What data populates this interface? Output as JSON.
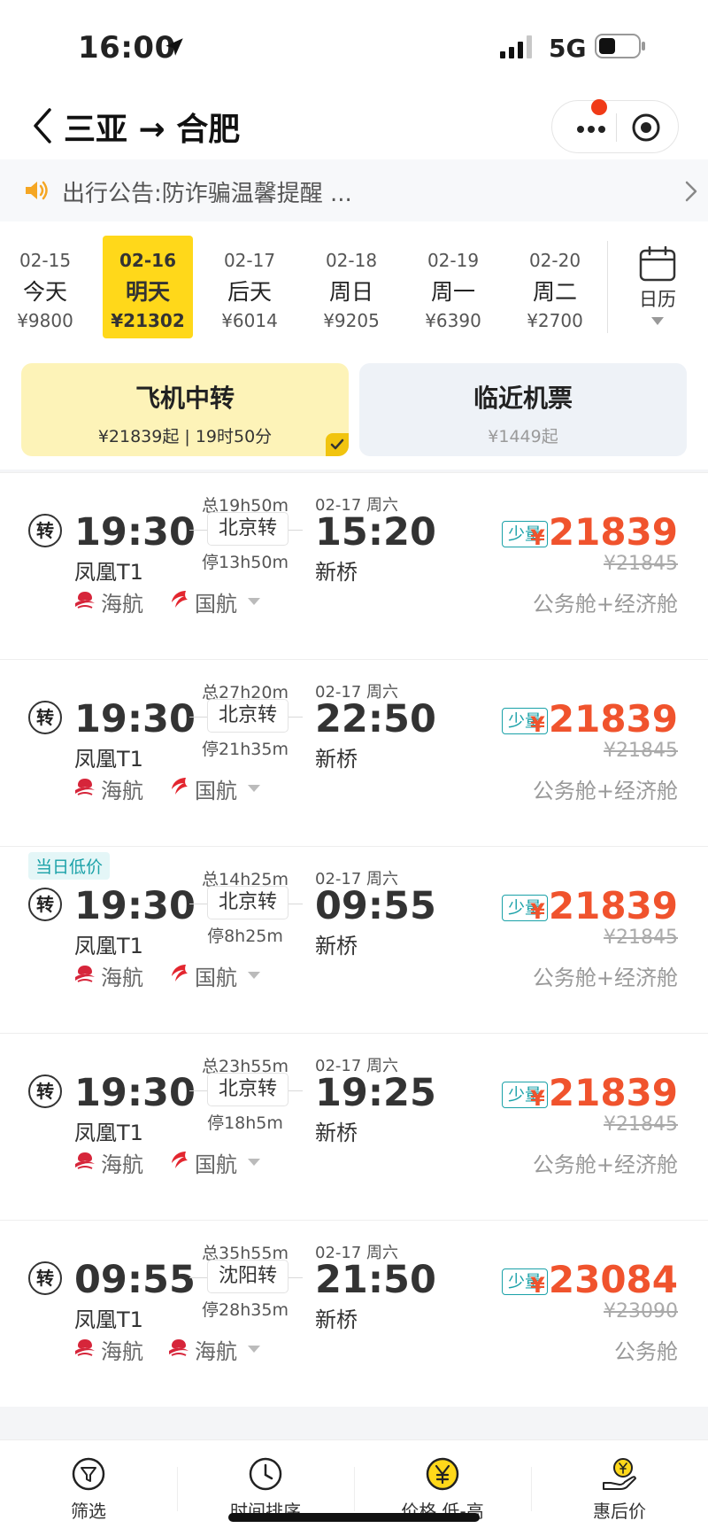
{
  "status_bar": {
    "time": "16:00",
    "network": "5G"
  },
  "header": {
    "title": "三亚 → 合肥"
  },
  "notice": {
    "text": "出行公告:防诈骗温馨提醒 ..."
  },
  "dates": [
    {
      "date": "02-15",
      "day": "今天",
      "price": "¥9800",
      "active": false
    },
    {
      "date": "02-16",
      "day": "明天",
      "price": "¥21302",
      "active": true
    },
    {
      "date": "02-17",
      "day": "后天",
      "price": "¥6014",
      "active": false
    },
    {
      "date": "02-18",
      "day": "周日",
      "price": "¥9205",
      "active": false
    },
    {
      "date": "02-19",
      "day": "周一",
      "price": "¥6390",
      "active": false
    },
    {
      "date": "02-20",
      "day": "周二",
      "price": "¥2700",
      "active": false
    }
  ],
  "calendar": {
    "label": "日历"
  },
  "type_tabs": [
    {
      "title": "飞机中转",
      "sub": "¥21839起 | 19时50分",
      "selected": true
    },
    {
      "title": "临近机票",
      "sub": "¥1449起",
      "selected": false
    }
  ],
  "flights": [
    {
      "tag": "",
      "transfer_mark": "转",
      "dep_time": "19:30",
      "dep_airport": "凤凰T1",
      "total": "总19h50m",
      "via": "北京转",
      "stop": "停13h50m",
      "arr_date": "02-17 周六",
      "arr_time": "15:20",
      "arr_airport": "新桥",
      "airline1": "海航",
      "airline2": "国航",
      "few": "少量",
      "price": "21839",
      "original": "¥21845",
      "cabin": "公务舱+经济舱"
    },
    {
      "tag": "",
      "transfer_mark": "转",
      "dep_time": "19:30",
      "dep_airport": "凤凰T1",
      "total": "总27h20m",
      "via": "北京转",
      "stop": "停21h35m",
      "arr_date": "02-17 周六",
      "arr_time": "22:50",
      "arr_airport": "新桥",
      "airline1": "海航",
      "airline2": "国航",
      "few": "少量",
      "price": "21839",
      "original": "¥21845",
      "cabin": "公务舱+经济舱"
    },
    {
      "tag": "当日低价",
      "transfer_mark": "转",
      "dep_time": "19:30",
      "dep_airport": "凤凰T1",
      "total": "总14h25m",
      "via": "北京转",
      "stop": "停8h25m",
      "arr_date": "02-17 周六",
      "arr_time": "09:55",
      "arr_airport": "新桥",
      "airline1": "海航",
      "airline2": "国航",
      "few": "少量",
      "price": "21839",
      "original": "¥21845",
      "cabin": "公务舱+经济舱"
    },
    {
      "tag": "",
      "transfer_mark": "转",
      "dep_time": "19:30",
      "dep_airport": "凤凰T1",
      "total": "总23h55m",
      "via": "北京转",
      "stop": "停18h5m",
      "arr_date": "02-17 周六",
      "arr_time": "19:25",
      "arr_airport": "新桥",
      "airline1": "海航",
      "airline2": "国航",
      "few": "少量",
      "price": "21839",
      "original": "¥21845",
      "cabin": "公务舱+经济舱"
    },
    {
      "tag": "",
      "transfer_mark": "转",
      "dep_time": "09:55",
      "dep_airport": "凤凰T1",
      "total": "总35h55m",
      "via": "沈阳转",
      "stop": "停28h35m",
      "arr_date": "02-17 周六",
      "arr_time": "21:50",
      "arr_airport": "新桥",
      "airline1": "海航",
      "airline2": "海航",
      "few": "少量",
      "price": "23084",
      "original": "¥23090",
      "cabin": "公务舱"
    }
  ],
  "currency": "¥",
  "bottom_tabs": [
    {
      "label": "筛选",
      "icon": "filter-icon"
    },
    {
      "label": "时间排序",
      "icon": "clock-icon"
    },
    {
      "label": "价格 低-高",
      "icon": "yen-icon"
    },
    {
      "label": "惠后价",
      "icon": "discount-hand-icon"
    }
  ],
  "colors": {
    "accent": "#ffd81a",
    "price": "#f0532d",
    "teal": "#1aa1a8",
    "hainan": "#d6253a",
    "airchina": "#e3262f"
  }
}
